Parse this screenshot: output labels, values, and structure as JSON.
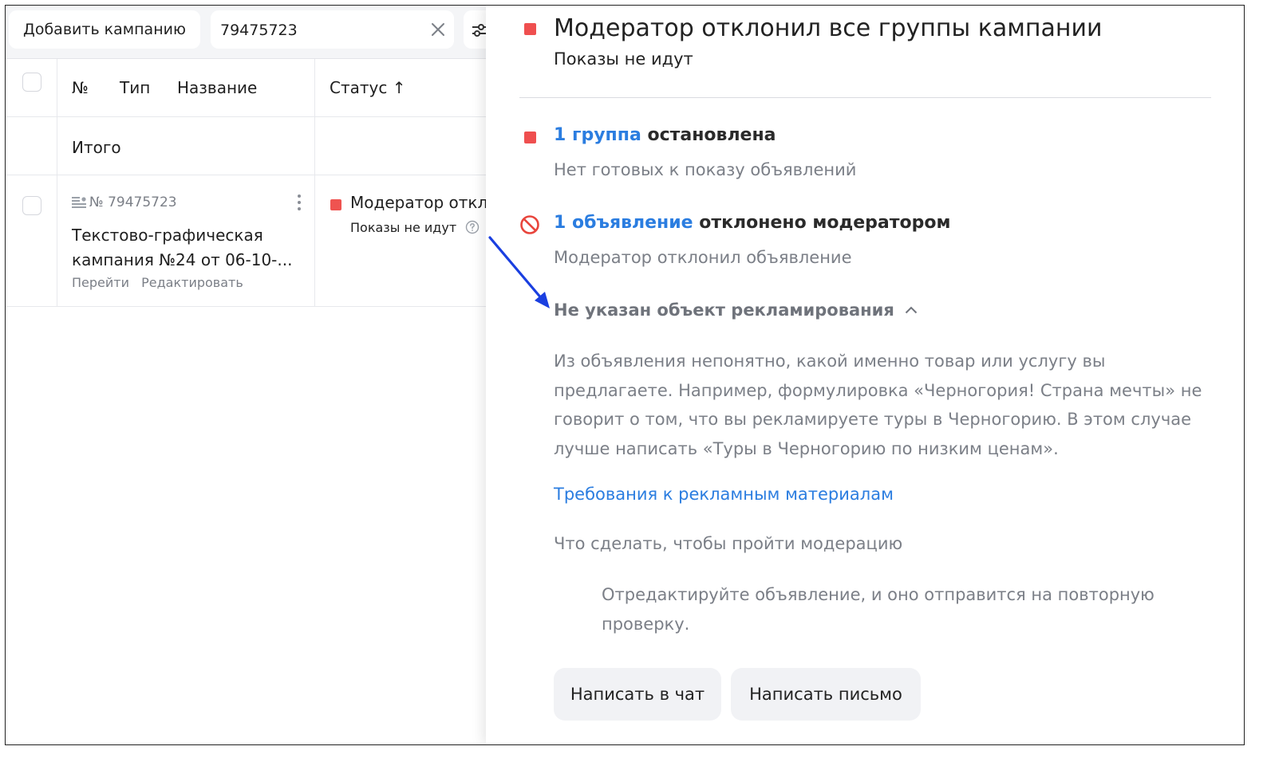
{
  "toolbar": {
    "add_campaign_label": "Добавить кампанию",
    "search_value": "79475723"
  },
  "table": {
    "headers": {
      "number": "№",
      "type": "Тип",
      "name": "Название",
      "status": "Статус ↑"
    },
    "total_label": "Итого",
    "campaign": {
      "id": "№ 79475723",
      "name": "Текстово-графическая кампания №24 от 06-10-...",
      "link_go": "Перейти",
      "link_edit": "Редактировать",
      "status_title": "Модератор откло",
      "status_sub": "Показы не идут"
    }
  },
  "panel": {
    "title": "Модератор отклонил все группы кампании",
    "subtitle": "Показы не идут",
    "group_link": "1 группа",
    "group_state": " остановлена",
    "group_desc": "Нет готовых к показу объявлений",
    "ad_link": "1 объявление",
    "ad_state": " отклонено модератором",
    "ad_desc": "Модератор отклонил объявление",
    "reason_title": "Не указан объект рекламирования",
    "reason_text": "Из объявления непонятно, какой именно товар или услугу вы предлагаете. Например, формулировка «Черногория! Страна мечты» не говорит о том, что вы рекламируете туры в Черногорию. В этом случае лучше написать «Туры в Черногорию по низким ценам».",
    "requirements_link": "Требования к рекламным материалам",
    "todo_title": "Что сделать, чтобы пройти модерацию",
    "todo_text": "Отредактируйте объявление, и оно отправится на повторную проверку.",
    "chat_button": "Написать в чат",
    "email_button": "Написать письмо"
  },
  "colors": {
    "status_red": "#ef4f4f",
    "link_blue": "#2b7de0",
    "annotation_arrow": "#1a3fe0"
  }
}
